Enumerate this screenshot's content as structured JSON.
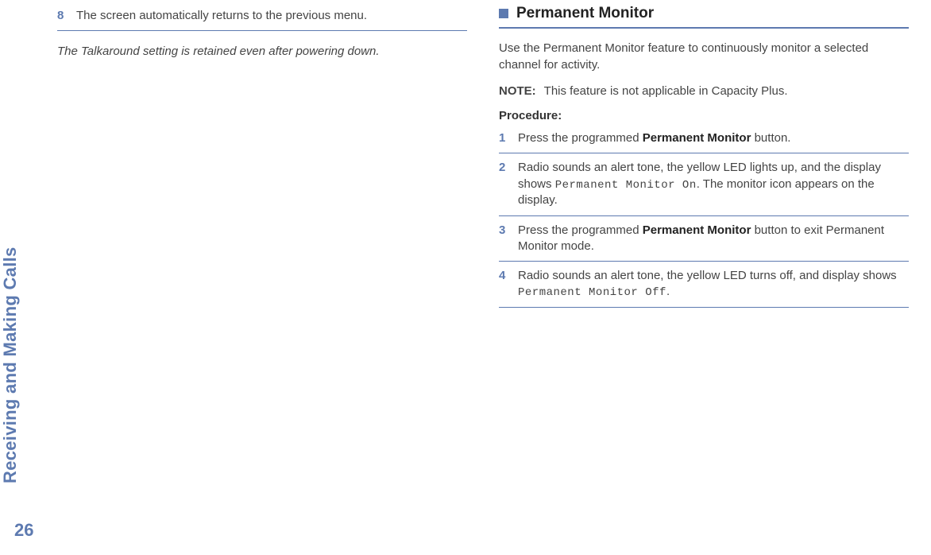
{
  "sidebar": {
    "label": "Receiving and Making Calls",
    "page_number": "26"
  },
  "left": {
    "step8_num": "8",
    "step8_text": "The screen automatically returns to the previous menu.",
    "italic_note": "The Talkaround setting is retained even after powering down."
  },
  "right": {
    "section_title": "Permanent Monitor",
    "intro": "Use the Permanent Monitor feature to continuously monitor a selected channel for activity.",
    "note_label": "NOTE:",
    "note_text": "This feature is not applicable in Capacity Plus.",
    "procedure_label": "Procedure:",
    "steps": {
      "s1_num": "1",
      "s1_a": "Press the programmed ",
      "s1_b": "Permanent Monitor",
      "s1_c": " button.",
      "s2_num": "2",
      "s2_a": "Radio sounds an alert tone, the yellow LED lights up, and the display shows ",
      "s2_b": "Permanent Monitor On",
      "s2_c": ". The monitor icon appears on the display.",
      "s3_num": "3",
      "s3_a": "Press the programmed ",
      "s3_b": "Permanent Monitor",
      "s3_c": " button to exit Permanent Monitor mode.",
      "s4_num": "4",
      "s4_a": "Radio sounds an alert tone, the yellow LED turns off, and display shows ",
      "s4_b": "Permanent Monitor Off",
      "s4_c": "."
    }
  }
}
